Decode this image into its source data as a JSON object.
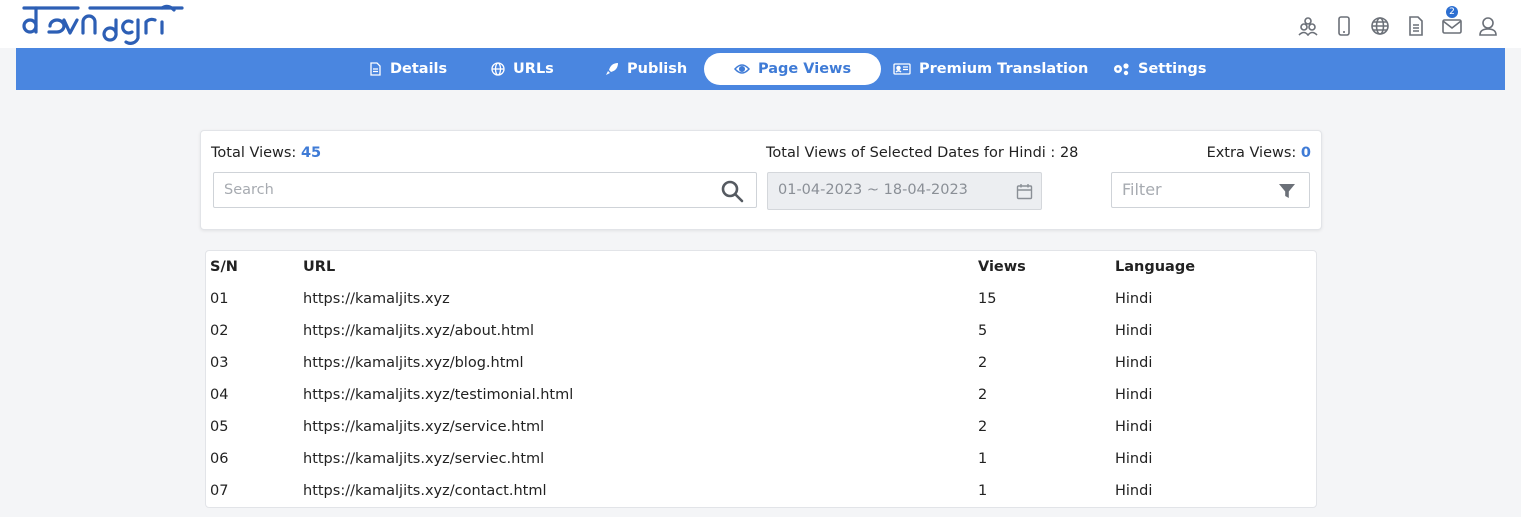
{
  "brand": {
    "logo_text": "devnagri",
    "logo_color": "#2d5fb5"
  },
  "top_icons": {
    "items": [
      "team-icon",
      "mobile-icon",
      "globe-icon",
      "document-icon",
      "mail-icon",
      "user-icon"
    ],
    "mail_badge": "2"
  },
  "nav": {
    "items": [
      {
        "label": "Details",
        "icon": "document-icon"
      },
      {
        "label": "URLs",
        "icon": "globe-icon"
      },
      {
        "label": "Publish",
        "icon": "rocket-icon"
      },
      {
        "label": "Page Views",
        "icon": "eye-icon",
        "active": true
      },
      {
        "label": "Premium Translation",
        "icon": "id-card-icon"
      },
      {
        "label": "Settings",
        "icon": "gears-icon"
      }
    ],
    "color": "#4a86e0"
  },
  "stats": {
    "total_label": "Total Views:",
    "total_value": "45",
    "selected_label": "Total Views of Selected Dates for Hindi :",
    "selected_value": "28",
    "extra_label": "Extra Views:",
    "extra_value": "0"
  },
  "search": {
    "placeholder": "Search"
  },
  "date_range": {
    "value": "01-04-2023 ~ 18-04-2023"
  },
  "filter": {
    "placeholder": "Filter"
  },
  "table": {
    "columns": {
      "sn": "S/N",
      "url": "URL",
      "views": "Views",
      "language": "Language"
    },
    "rows": [
      {
        "sn": "01",
        "url": "https://kamaljits.xyz",
        "views": "15",
        "language": "Hindi"
      },
      {
        "sn": "02",
        "url": "https://kamaljits.xyz/about.html",
        "views": "5",
        "language": "Hindi"
      },
      {
        "sn": "03",
        "url": "https://kamaljits.xyz/blog.html",
        "views": "2",
        "language": "Hindi"
      },
      {
        "sn": "04",
        "url": "https://kamaljits.xyz/testimonial.html",
        "views": "2",
        "language": "Hindi"
      },
      {
        "sn": "05",
        "url": "https://kamaljits.xyz/service.html",
        "views": "2",
        "language": "Hindi"
      },
      {
        "sn": "06",
        "url": "https://kamaljits.xyz/serviec.html",
        "views": "1",
        "language": "Hindi"
      },
      {
        "sn": "07",
        "url": "https://kamaljits.xyz/contact.html",
        "views": "1",
        "language": "Hindi"
      }
    ]
  }
}
